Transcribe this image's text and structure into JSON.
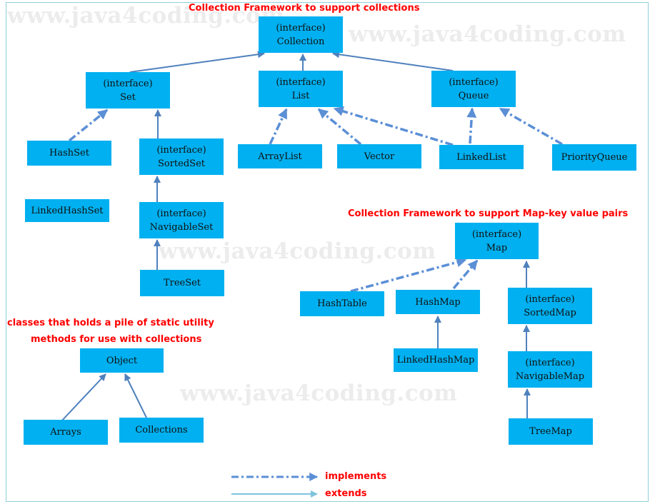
{
  "watermark": "www.java4coding.com",
  "headings": {
    "collections": "Collection Framework to support collections",
    "map": "Collection Framework to support Map-key value pairs",
    "utility_line1": "classes that holds a pile of static utility",
    "utility_line2": "methods for use with collections"
  },
  "nodes": {
    "collection": {
      "stereotype": "(interface)",
      "name": "Collection"
    },
    "set": {
      "stereotype": "(interface)",
      "name": "Set"
    },
    "list": {
      "stereotype": "(interface)",
      "name": "List"
    },
    "queue": {
      "stereotype": "(interface)",
      "name": "Queue"
    },
    "hashset": {
      "name": "HashSet"
    },
    "sortedset": {
      "stereotype": "(interface)",
      "name": "SortedSet"
    },
    "arraylist": {
      "name": "ArrayList"
    },
    "vector": {
      "name": "Vector"
    },
    "linkedlist": {
      "name": "LinkedList"
    },
    "priorityqueue": {
      "name": "PriorityQueue"
    },
    "linkedhashset": {
      "name": "LinkedHashSet"
    },
    "navigableset": {
      "stereotype": "(interface)",
      "name": "NavigableSet"
    },
    "treeset": {
      "name": "TreeSet"
    },
    "map": {
      "stereotype": "(interface)",
      "name": "Map"
    },
    "hashtable": {
      "name": "HashTable"
    },
    "hashmap": {
      "name": "HashMap"
    },
    "sortedmap": {
      "stereotype": "(interface)",
      "name": "SortedMap"
    },
    "linkedhashmap": {
      "name": "LinkedHashMap"
    },
    "navigablemap": {
      "stereotype": "(interface)",
      "name": "NavigableMap"
    },
    "treemap": {
      "name": "TreeMap"
    },
    "object": {
      "name": "Object"
    },
    "arrays": {
      "name": "Arrays"
    },
    "collections": {
      "name": "Collections"
    }
  },
  "edges": [
    {
      "from": "set",
      "to": "collection",
      "type": "extends"
    },
    {
      "from": "list",
      "to": "collection",
      "type": "extends"
    },
    {
      "from": "queue",
      "to": "collection",
      "type": "extends"
    },
    {
      "from": "hashset",
      "to": "set",
      "type": "implements"
    },
    {
      "from": "sortedset",
      "to": "set",
      "type": "extends"
    },
    {
      "from": "navigableset",
      "to": "sortedset",
      "type": "extends"
    },
    {
      "from": "treeset",
      "to": "navigableset",
      "type": "extends"
    },
    {
      "from": "arraylist",
      "to": "list",
      "type": "implements"
    },
    {
      "from": "vector",
      "to": "list",
      "type": "implements"
    },
    {
      "from": "linkedlist",
      "to": "list",
      "type": "implements"
    },
    {
      "from": "linkedlist",
      "to": "queue",
      "type": "implements"
    },
    {
      "from": "priorityqueue",
      "to": "queue",
      "type": "implements"
    },
    {
      "from": "hashtable",
      "to": "map",
      "type": "implements"
    },
    {
      "from": "hashmap",
      "to": "map",
      "type": "implements"
    },
    {
      "from": "linkedhashmap",
      "to": "hashmap",
      "type": "extends"
    },
    {
      "from": "sortedmap",
      "to": "map",
      "type": "extends"
    },
    {
      "from": "navigablemap",
      "to": "sortedmap",
      "type": "extends"
    },
    {
      "from": "treemap",
      "to": "navigablemap",
      "type": "extends"
    },
    {
      "from": "arrays",
      "to": "object",
      "type": "extends"
    },
    {
      "from": "collections",
      "to": "object",
      "type": "extends"
    }
  ],
  "legend": {
    "implements": "implements",
    "extends": "extends"
  },
  "colors": {
    "node_fill": "#00b0f0",
    "edge": "#4f81bd",
    "dashed_edge": "#5b8fd6",
    "legend_extends": "#7cc4dc",
    "heading": "#ff0000",
    "frame": "#8fd0dc"
  }
}
